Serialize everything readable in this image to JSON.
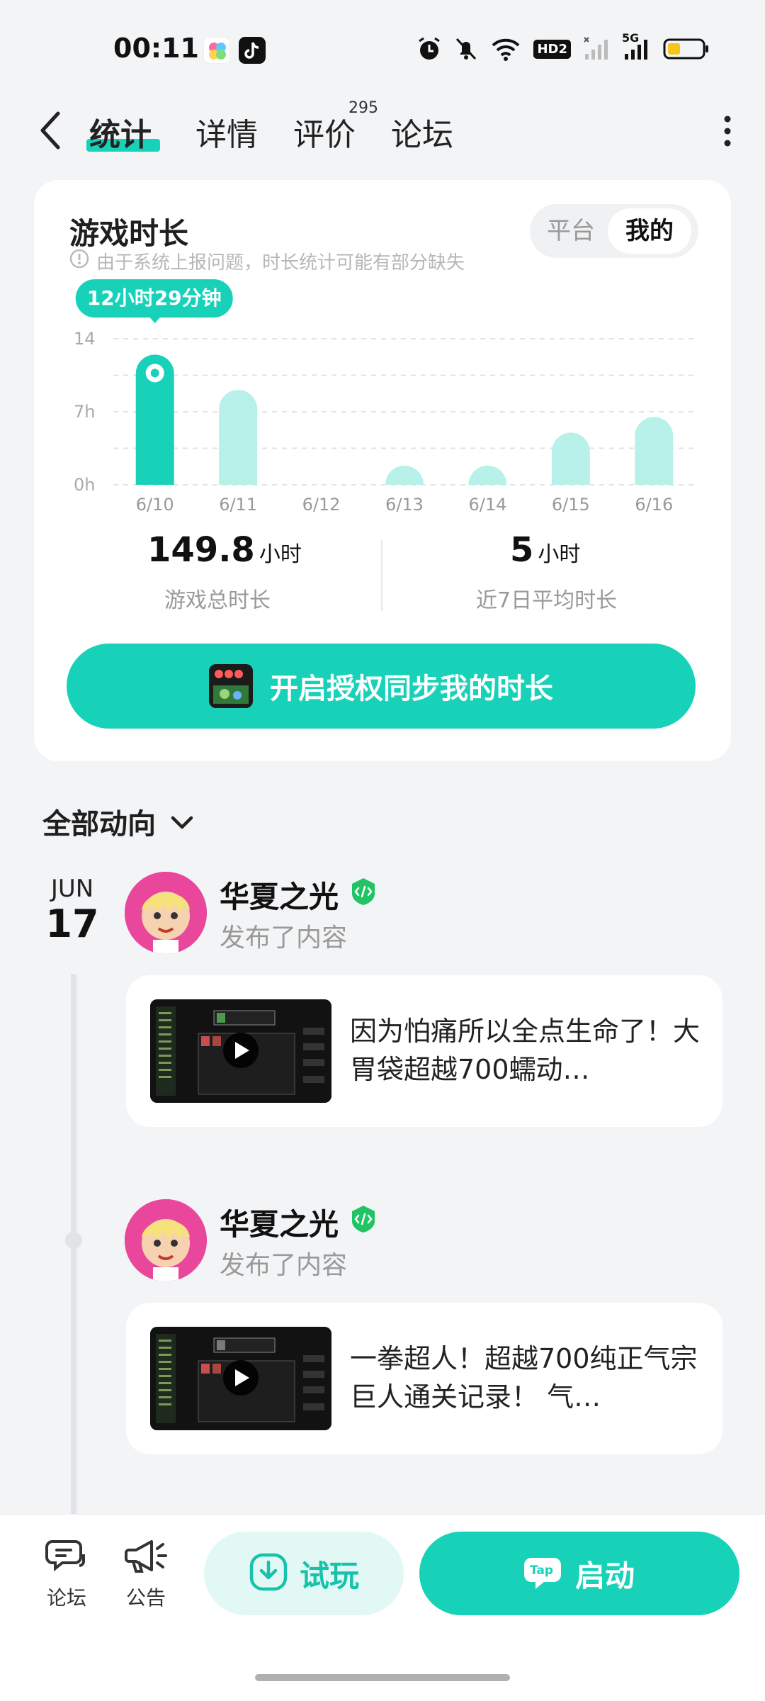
{
  "status_bar": {
    "time": "00:11",
    "apps": [
      "colorful-app-icon",
      "tiktok-icon"
    ],
    "icons": [
      "alarm-icon",
      "mute-icon",
      "wifi-icon",
      "hd-icon",
      "signal-icon",
      "5g-signal-icon",
      "battery-icon"
    ],
    "hd_text": "HD2",
    "fiveg_text": "5G"
  },
  "nav": {
    "tabs": [
      {
        "label": "统计",
        "active": true
      },
      {
        "label": "详情",
        "active": false
      },
      {
        "label": "评价",
        "active": false,
        "badge": "295"
      },
      {
        "label": "论坛",
        "active": false
      }
    ]
  },
  "card": {
    "title": "游戏时长",
    "note": "由于系统上报问题，时长统计可能有部分缺失",
    "toggle": {
      "off": "平台",
      "on": "我的"
    },
    "highlight_label": "12小时29分钟",
    "stats": [
      {
        "value": "149.8",
        "unit": "小时",
        "caption": "游戏总时长"
      },
      {
        "value": "5",
        "unit": "小时",
        "caption": "近7日平均时长"
      }
    ],
    "sync_button": "开启授权同步我的时长"
  },
  "chart_data": {
    "type": "bar",
    "categories": [
      "6/10",
      "6/11",
      "6/12",
      "6/13",
      "6/14",
      "6/15",
      "6/16"
    ],
    "values": [
      12.48,
      9.1,
      0,
      1.8,
      0.8,
      5.0,
      6.5
    ],
    "y_ticks": [
      "0h",
      "7h",
      "14"
    ],
    "ylim": [
      0,
      14
    ],
    "highlight_index": 0,
    "colors": {
      "highlight": "#17d2b9",
      "normal": "#b7f1e9"
    }
  },
  "feed": {
    "filter_label": "全部动向",
    "date": {
      "month": "JUN",
      "day": "17"
    },
    "posts": [
      {
        "user": "华夏之光",
        "action": "发布了内容",
        "text": "因为怕痛所以全点生命了！大胃袋超越700蠕动…"
      },
      {
        "user": "华夏之光",
        "action": "发布了内容",
        "text": "一拳超人！超越700纯正气宗巨人通关记录！ 气…"
      }
    ]
  },
  "bottom_bar": {
    "forum": "论坛",
    "announce": "公告",
    "try": "试玩",
    "launch": "启动",
    "launch_icon_text": "Tap"
  },
  "colors": {
    "accent": "#17d2b9",
    "accent_light": "#b7f1e9"
  }
}
